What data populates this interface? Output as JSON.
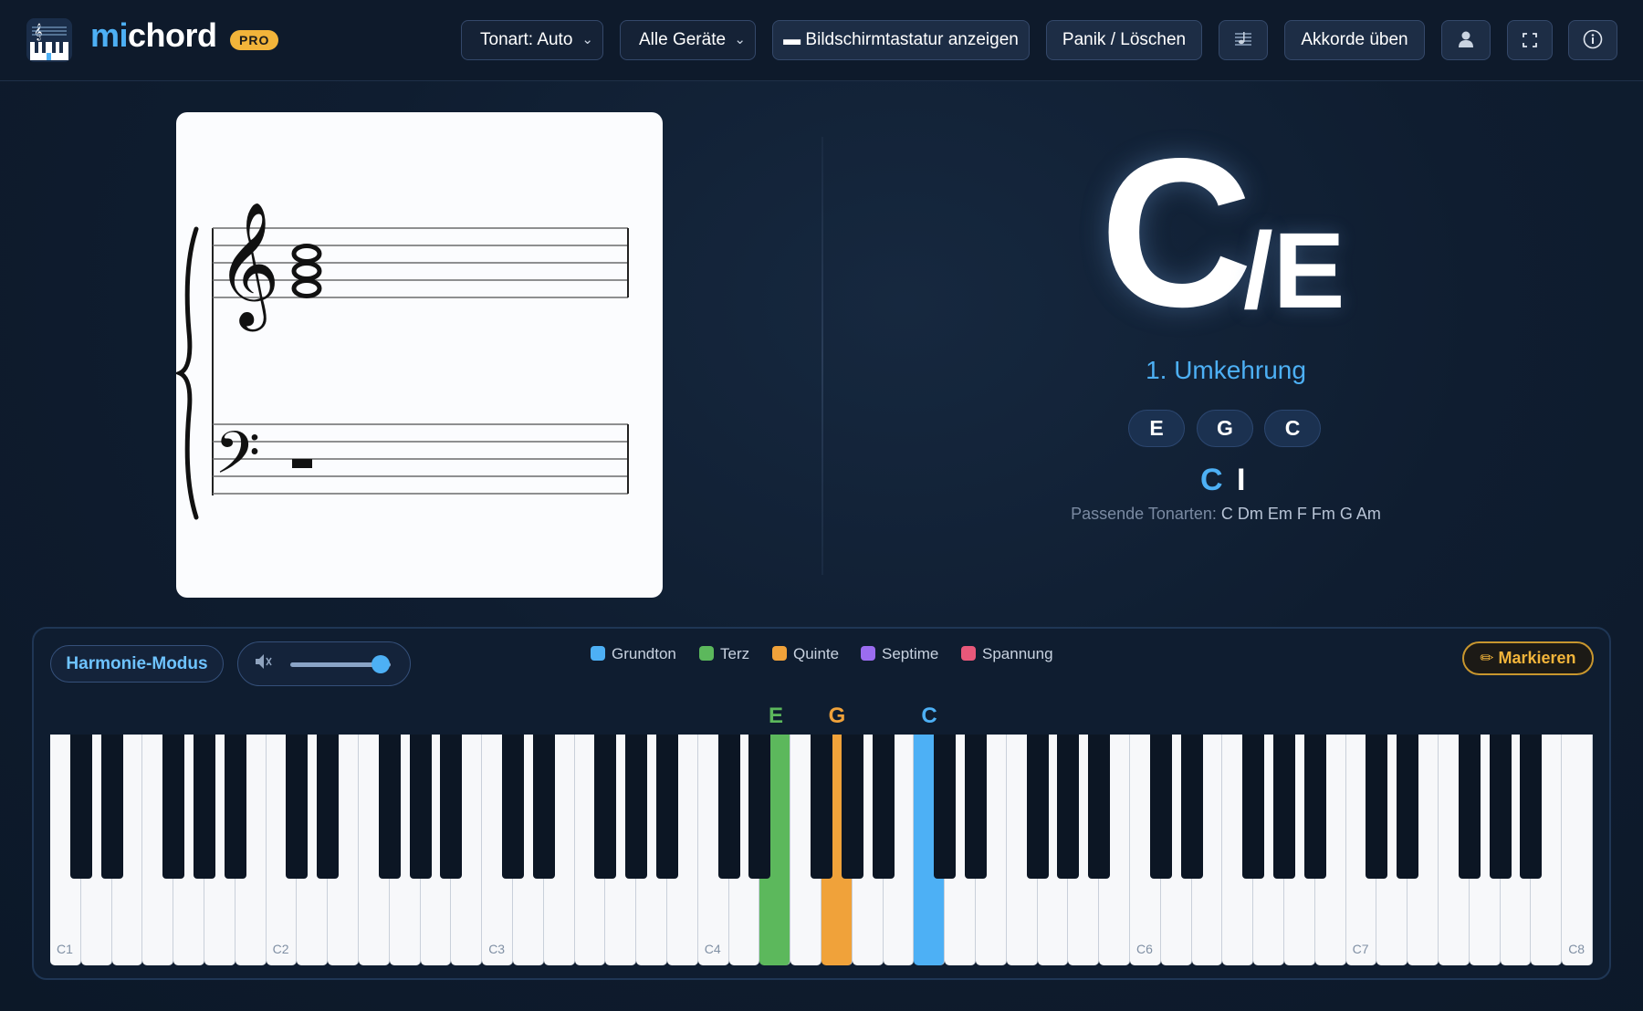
{
  "header": {
    "logo_title_mi": "mi",
    "logo_title_chord": "chord",
    "badge": "PRO",
    "key_select": "Tonart: Auto",
    "device_select": "Alle Geräte",
    "keyboard_toggle": "▬ Bildschirmtastatur anzeigen",
    "panic_button": "Panik / Löschen",
    "practice_button": "Akkorde üben",
    "icons": [
      "sheet-music-icon",
      "user-icon",
      "fullscreen-icon",
      "info-icon"
    ]
  },
  "chord": {
    "root": "C",
    "slash": "/E",
    "inversion": "1. Umkehrung",
    "notes": [
      "E",
      "G",
      "C"
    ],
    "key_root": "C",
    "roman": "I",
    "keys_label": "Passende Tonarten:",
    "keys_values": "C Dm Em F Fm G Am"
  },
  "controls": {
    "mode_button": "Harmonie-Modus",
    "volume_icon": "speaker-icon",
    "volume_level": 0.9,
    "mark_button": "✏ Markieren"
  },
  "legend": [
    {
      "label": "Grundton",
      "color": "#4db0f5"
    },
    {
      "label": "Terz",
      "color": "#5cb85c"
    },
    {
      "label": "Quinte",
      "color": "#f0a23a"
    },
    {
      "label": "Septime",
      "color": "#9b6cf0"
    },
    {
      "label": "Spannung",
      "color": "#e8587a"
    }
  ],
  "keyboard": {
    "octave_labels": [
      "C1",
      "C2",
      "C3",
      "C4",
      "C6",
      "C7",
      "C8"
    ],
    "highlight_labels": [
      {
        "note": "E",
        "color": "#5cb85c"
      },
      {
        "note": "G",
        "color": "#f0a23a"
      },
      {
        "note": "C",
        "color": "#4db0f5"
      }
    ],
    "colors": {
      "root": "#4db0f5",
      "third": "#5cb85c",
      "fifth": "#f0a23a"
    }
  }
}
